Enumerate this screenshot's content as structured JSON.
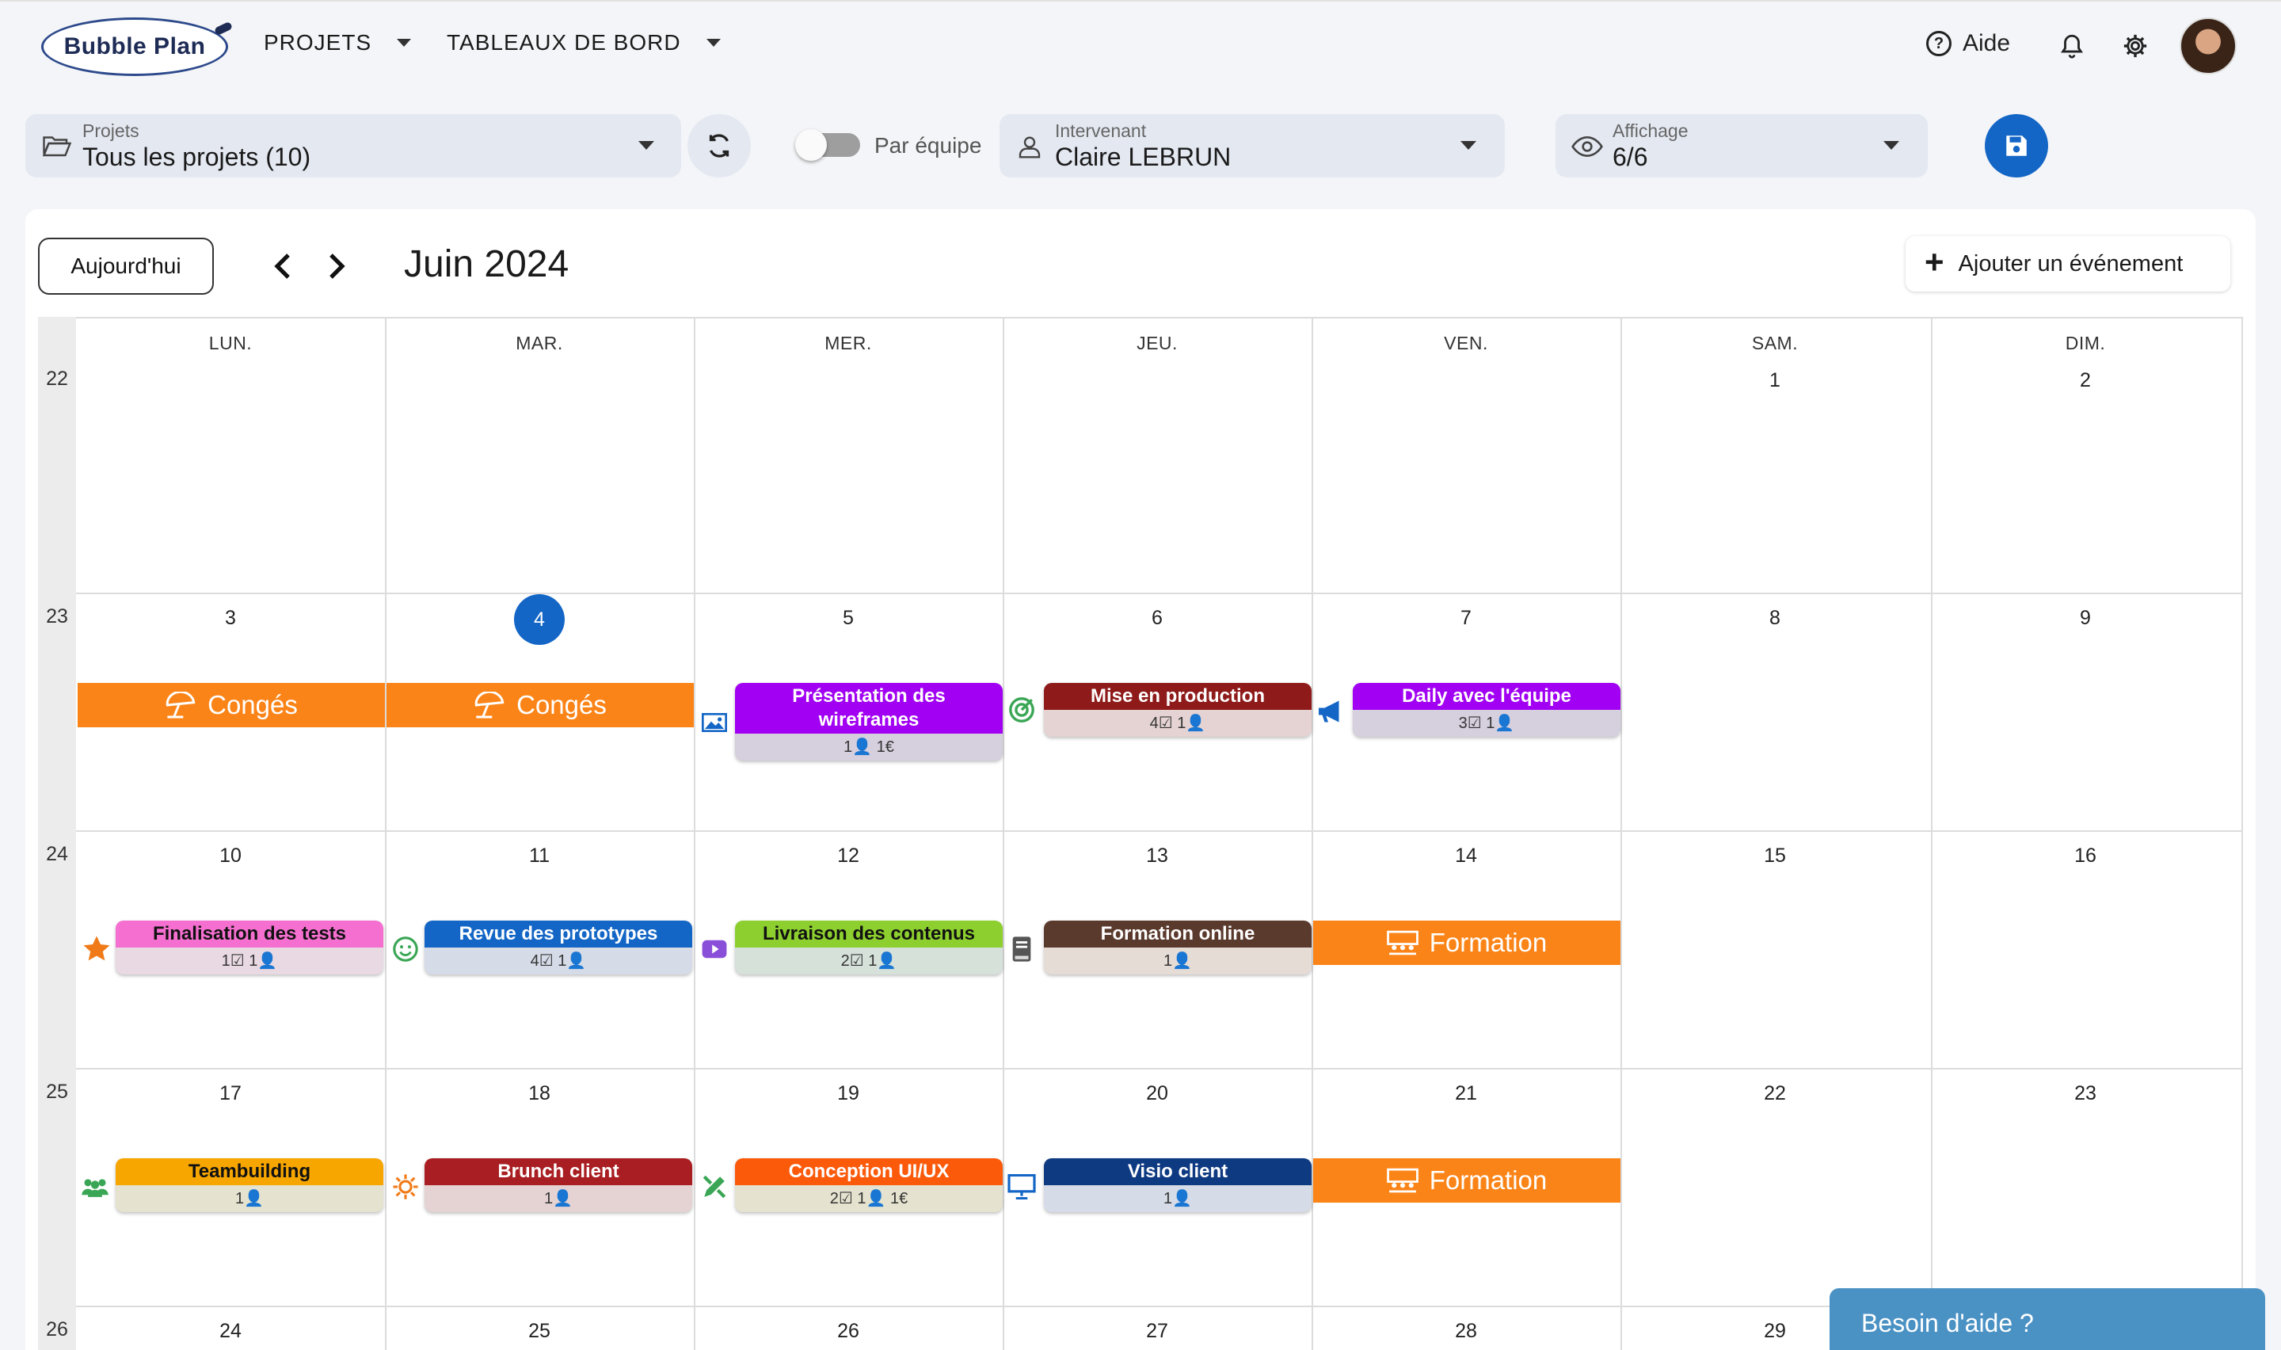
{
  "nav": {
    "logo": "Bubble Plan",
    "projets": "PROJETS",
    "tableaux": "TABLEAUX DE BORD",
    "aide": "Aide"
  },
  "filters": {
    "projets_label": "Projets",
    "projets_value": "Tous les projets (10)",
    "par_equipe": "Par équipe",
    "intervenant_label": "Intervenant",
    "intervenant_value": "Claire LEBRUN",
    "affichage_label": "Affichage",
    "affichage_value": "6/6"
  },
  "calendar": {
    "today_label": "Aujourd'hui",
    "month": "Juin 2024",
    "add_event": "Ajouter un événement",
    "days": [
      "LUN.",
      "MAR.",
      "MER.",
      "JEU.",
      "VEN.",
      "SAM.",
      "DIM."
    ],
    "weeks": [
      {
        "num": "22",
        "dates": [
          "",
          "",
          "",
          "",
          "",
          "1",
          "2"
        ]
      },
      {
        "num": "23",
        "dates": [
          "3",
          "4",
          "5",
          "6",
          "7",
          "8",
          "9"
        ]
      },
      {
        "num": "24",
        "dates": [
          "10",
          "11",
          "12",
          "13",
          "14",
          "15",
          "16"
        ]
      },
      {
        "num": "25",
        "dates": [
          "17",
          "18",
          "19",
          "20",
          "21",
          "22",
          "23"
        ]
      },
      {
        "num": "26",
        "dates": [
          "24",
          "25",
          "26",
          "27",
          "28",
          "29",
          ""
        ]
      }
    ],
    "today_date": "4"
  },
  "events": {
    "conges": "Congés",
    "formation": "Formation",
    "presentation": {
      "title": "Présentation des wireframes",
      "meta": "1👤 1€",
      "color": "#a100f2"
    },
    "mise_prod": {
      "title": "Mise en production",
      "meta": "4☑ 1👤",
      "color": "#8e1a1a"
    },
    "daily": {
      "title": "Daily avec l'équipe",
      "meta": "3☑ 1👤",
      "color": "#a100f2"
    },
    "finalisation": {
      "title": "Finalisation des tests",
      "meta": "1☑ 1👤",
      "color": "#f56fd0"
    },
    "revue": {
      "title": "Revue des prototypes",
      "meta": "4☑ 1👤",
      "color": "#1366c6"
    },
    "livraison": {
      "title": "Livraison des contenus",
      "meta": "2☑ 1👤",
      "color": "#8ccf2e"
    },
    "formation_online": {
      "title": "Formation online",
      "meta": "1👤",
      "color": "#5b3a2e"
    },
    "teambuilding": {
      "title": "Teambuilding",
      "meta": "1👤",
      "color": "#f7a600"
    },
    "brunch": {
      "title": "Brunch client",
      "meta": "1👤",
      "color": "#a91e22"
    },
    "conception": {
      "title": "Conception UI/UX",
      "meta": "2☑ 1👤 1€",
      "color": "#fb5a0b"
    },
    "visio": {
      "title": "Visio client",
      "meta": "1👤",
      "color": "#0e3a82"
    }
  },
  "help_widget": "Besoin d'aide ?",
  "colors": {
    "accent": "#1366c6",
    "allday_orange": "#fb8418"
  }
}
